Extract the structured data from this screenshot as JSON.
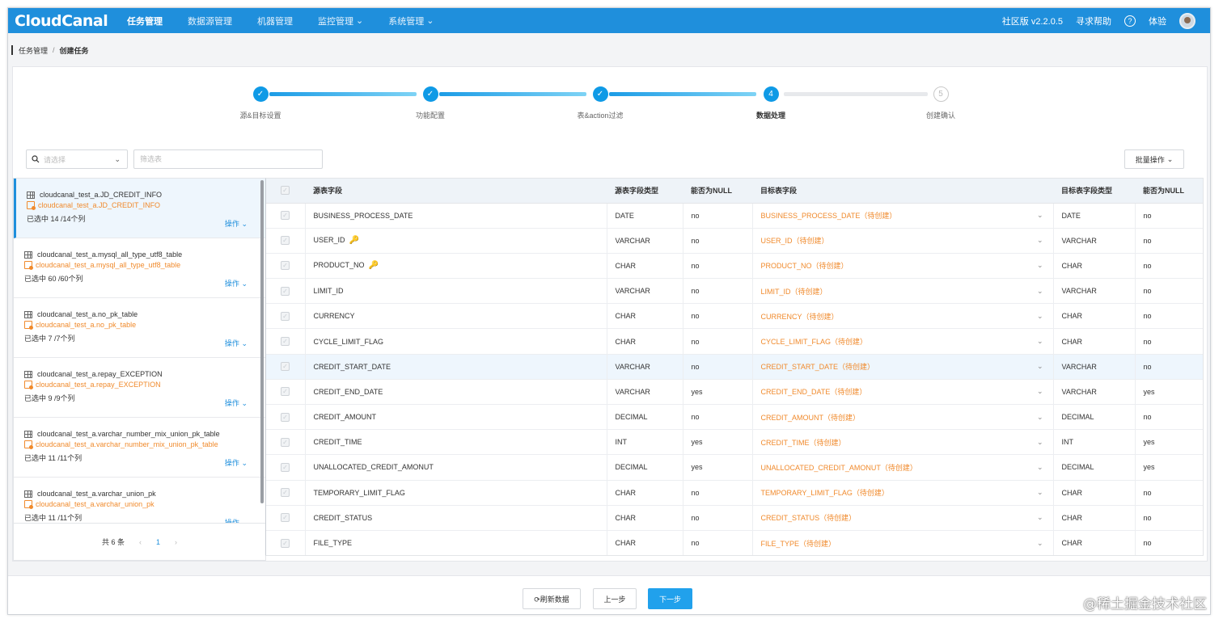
{
  "brand": {
    "logo": "CloudCanal"
  },
  "nav": {
    "items": [
      {
        "label": "任务管理",
        "active": true,
        "dropdown": false
      },
      {
        "label": "数据源管理",
        "active": false,
        "dropdown": false
      },
      {
        "label": "机器管理",
        "active": false,
        "dropdown": false
      },
      {
        "label": "监控管理",
        "active": false,
        "dropdown": true
      },
      {
        "label": "系统管理",
        "active": false,
        "dropdown": true
      }
    ],
    "version": "社区版 v2.2.0.5",
    "help": "寻求帮助",
    "help_icon": "?",
    "user": "体验"
  },
  "breadcrumb": {
    "parent": "任务管理",
    "separator": "/",
    "current": "创建任务"
  },
  "steps": [
    {
      "label": "源&目标设置",
      "mark": "✓",
      "state": "done"
    },
    {
      "label": "功能配置",
      "mark": "✓",
      "state": "done"
    },
    {
      "label": "表&action过滤",
      "mark": "✓",
      "state": "done"
    },
    {
      "label": "数据处理",
      "mark": "4",
      "state": "current"
    },
    {
      "label": "创建确认",
      "mark": "5",
      "state": "pending"
    }
  ],
  "filters": {
    "select_placeholder": "请选择",
    "filter_placeholder": "筛选表",
    "batch_label": "批量操作"
  },
  "tables": [
    {
      "src": "cloudcanal_test_a.JD_CREDIT_INFO",
      "dst": "cloudcanal_test_a.JD_CREDIT_INFO",
      "count": "已选中 14 /14个列",
      "op": "操作",
      "selected": true
    },
    {
      "src": "cloudcanal_test_a.mysql_all_type_utf8_table",
      "dst": "cloudcanal_test_a.mysql_all_type_utf8_table",
      "count": "已选中 60 /60个列",
      "op": "操作",
      "selected": false
    },
    {
      "src": "cloudcanal_test_a.no_pk_table",
      "dst": "cloudcanal_test_a.no_pk_table",
      "count": "已选中 7 /7个列",
      "op": "操作",
      "selected": false
    },
    {
      "src": "cloudcanal_test_a.repay_EXCEPTION",
      "dst": "cloudcanal_test_a.repay_EXCEPTION",
      "count": "已选中 9 /9个列",
      "op": "操作",
      "selected": false
    },
    {
      "src": "cloudcanal_test_a.varchar_number_mix_union_pk_table",
      "dst": "cloudcanal_test_a.varchar_number_mix_union_pk_table",
      "count": "已选中 11 /11个列",
      "op": "操作",
      "selected": false
    },
    {
      "src": "cloudcanal_test_a.varchar_union_pk",
      "dst": "cloudcanal_test_a.varchar_union_pk",
      "count": "已选中 11 /11个列",
      "op": "操作",
      "selected": false
    }
  ],
  "pager": {
    "total": "共 6 条",
    "page": "1",
    "prev": "‹",
    "next": "›"
  },
  "columns_header": {
    "check": "✓",
    "src_field": "源表字段",
    "src_type": "源表字段类型",
    "src_null": "能否为NULL",
    "dst_field": "目标表字段",
    "dst_type": "目标表字段类型",
    "dst_null": "能否为NULL"
  },
  "columns": [
    {
      "src": "BUSINESS_PROCESS_DATE",
      "key": false,
      "type": "DATE",
      "null": "no",
      "dst": "BUSINESS_PROCESS_DATE（待创建）",
      "dst_type": "DATE",
      "dst_null": "no",
      "highlight": false
    },
    {
      "src": "USER_ID",
      "key": true,
      "type": "VARCHAR",
      "null": "no",
      "dst": "USER_ID（待创建）",
      "dst_type": "VARCHAR",
      "dst_null": "no",
      "highlight": false
    },
    {
      "src": "PRODUCT_NO",
      "key": true,
      "type": "CHAR",
      "null": "no",
      "dst": "PRODUCT_NO（待创建）",
      "dst_type": "CHAR",
      "dst_null": "no",
      "highlight": false
    },
    {
      "src": "LIMIT_ID",
      "key": false,
      "type": "VARCHAR",
      "null": "no",
      "dst": "LIMIT_ID（待创建）",
      "dst_type": "VARCHAR",
      "dst_null": "no",
      "highlight": false
    },
    {
      "src": "CURRENCY",
      "key": false,
      "type": "CHAR",
      "null": "no",
      "dst": "CURRENCY（待创建）",
      "dst_type": "CHAR",
      "dst_null": "no",
      "highlight": false
    },
    {
      "src": "CYCLE_LIMIT_FLAG",
      "key": false,
      "type": "CHAR",
      "null": "no",
      "dst": "CYCLE_LIMIT_FLAG（待创建）",
      "dst_type": "CHAR",
      "dst_null": "no",
      "highlight": false
    },
    {
      "src": "CREDIT_START_DATE",
      "key": false,
      "type": "VARCHAR",
      "null": "no",
      "dst": "CREDIT_START_DATE（待创建）",
      "dst_type": "VARCHAR",
      "dst_null": "no",
      "highlight": true
    },
    {
      "src": "CREDIT_END_DATE",
      "key": false,
      "type": "VARCHAR",
      "null": "yes",
      "dst": "CREDIT_END_DATE（待创建）",
      "dst_type": "VARCHAR",
      "dst_null": "yes",
      "highlight": false
    },
    {
      "src": "CREDIT_AMOUNT",
      "key": false,
      "type": "DECIMAL",
      "null": "no",
      "dst": "CREDIT_AMOUNT（待创建）",
      "dst_type": "DECIMAL",
      "dst_null": "no",
      "highlight": false
    },
    {
      "src": "CREDIT_TIME",
      "key": false,
      "type": "INT",
      "null": "yes",
      "dst": "CREDIT_TIME（待创建）",
      "dst_type": "INT",
      "dst_null": "yes",
      "highlight": false
    },
    {
      "src": "UNALLOCATED_CREDIT_AMONUT",
      "key": false,
      "type": "DECIMAL",
      "null": "yes",
      "dst": "UNALLOCATED_CREDIT_AMONUT（待创建）",
      "dst_type": "DECIMAL",
      "dst_null": "yes",
      "highlight": false
    },
    {
      "src": "TEMPORARY_LIMIT_FLAG",
      "key": false,
      "type": "CHAR",
      "null": "no",
      "dst": "TEMPORARY_LIMIT_FLAG（待创建）",
      "dst_type": "CHAR",
      "dst_null": "no",
      "highlight": false
    },
    {
      "src": "CREDIT_STATUS",
      "key": false,
      "type": "CHAR",
      "null": "no",
      "dst": "CREDIT_STATUS（待创建）",
      "dst_type": "CHAR",
      "dst_null": "no",
      "highlight": false
    },
    {
      "src": "FILE_TYPE",
      "key": false,
      "type": "CHAR",
      "null": "no",
      "dst": "FILE_TYPE（待创建）",
      "dst_type": "CHAR",
      "dst_null": "no",
      "highlight": false
    }
  ],
  "footer": {
    "refresh": "⟳刷新数据",
    "prev": "上一步",
    "next": "下一步"
  },
  "watermark": "@稀土掘金技术社区",
  "colors": {
    "nav": "#1f8fdc",
    "accent": "#21a1ec",
    "target_text": "#f08a2c",
    "selected_row": "#eef6fd"
  }
}
